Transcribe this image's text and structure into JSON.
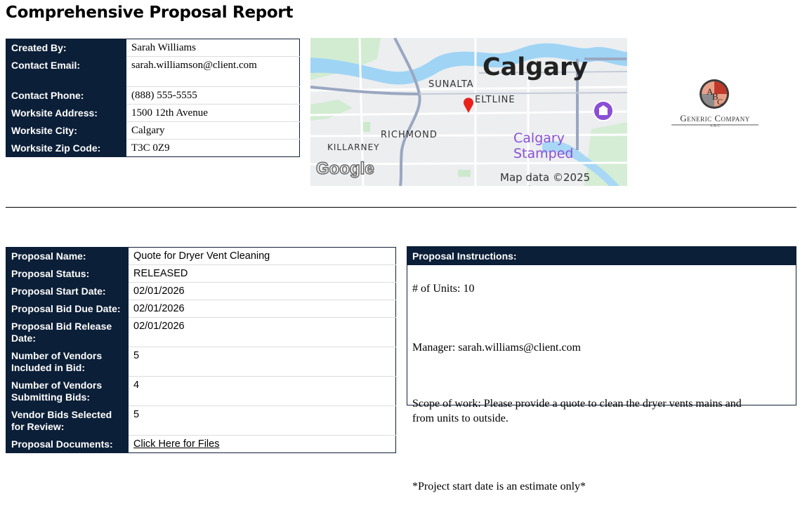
{
  "report_title": "Comprehensive Proposal Report",
  "contact": [
    {
      "label": "Created By:",
      "value": "Sarah Williams"
    },
    {
      "label": "Contact Email:",
      "value": "sarah.williamson@client.com"
    },
    {
      "label": "Contact Phone:",
      "value": "(888) 555-5555"
    },
    {
      "label": "Worksite Address:",
      "value": "1500 12th Avenue"
    },
    {
      "label": "Worksite City:",
      "value": "Calgary"
    },
    {
      "label": "Worksite Zip Code:",
      "value": "T3C 0Z9"
    }
  ],
  "map": {
    "city": "Calgary",
    "neighborhoods": [
      "SUNALTA",
      "ELTLINE",
      "RICHMOND",
      "KILLARNEY"
    ],
    "poi": "Calgary Stamped",
    "provider": "Google",
    "attribution": "Map data ©2025 Google",
    "poi_color": "#8b4fd6",
    "pin_color": "#e8221b"
  },
  "logo": {
    "monogram": "ABC",
    "company_name": "Generic Company",
    "tagline": "A B C"
  },
  "proposal": [
    {
      "label": "Proposal Name:",
      "value": "Quote for Dryer Vent Cleaning"
    },
    {
      "label": "Proposal Status:",
      "value": "RELEASED"
    },
    {
      "label": "Proposal Start Date:",
      "value": "02/01/2026"
    },
    {
      "label": "Proposal Bid Due Date:",
      "value": "02/01/2026"
    },
    {
      "label": "Proposal Bid Release Date:",
      "value": "02/01/2026"
    },
    {
      "label": "Number of Vendors Included in Bid:",
      "value": "5"
    },
    {
      "label": "Number of Vendors Submitting Bids:",
      "value": "4"
    },
    {
      "label": "Vendor Bids Selected for Review:",
      "value": "5"
    },
    {
      "label": "Proposal Documents:",
      "value": "Click Here for Files"
    }
  ],
  "instructions": {
    "header": "Proposal Instructions:",
    "units": "# of Units: 10",
    "manager": "Manager: sarah.williams@client.com",
    "scope": "Scope of work: Please provide a quote to clean the dryer vents mains and from units to outside.",
    "note": "*Project start date is an estimate only*"
  },
  "colors": {
    "header_navy": "#0c1f38"
  }
}
